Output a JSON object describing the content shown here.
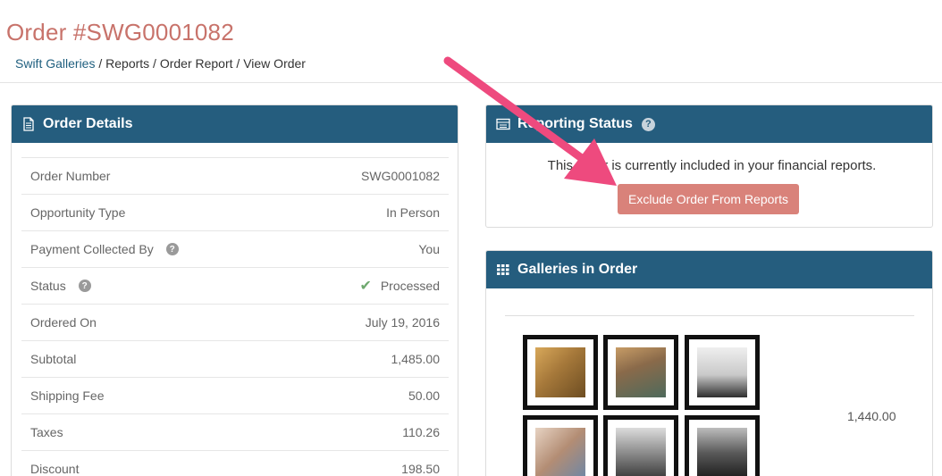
{
  "page": {
    "title": "Order #SWG0001082",
    "breadcrumb": {
      "home": "Swift Galleries",
      "rest": " / Reports / Order Report / View Order"
    }
  },
  "order_details": {
    "heading": "Order Details",
    "rows": [
      {
        "label": "Order Number",
        "value": "SWG0001082"
      },
      {
        "label": "Opportunity Type",
        "value": "In Person"
      },
      {
        "label": "Payment Collected By",
        "value": "You"
      },
      {
        "label": "Status",
        "value": "Processed"
      },
      {
        "label": "Ordered On",
        "value": "July 19, 2016"
      },
      {
        "label": "Subtotal",
        "value": "1,485.00"
      },
      {
        "label": "Shipping Fee",
        "value": "50.00"
      },
      {
        "label": "Taxes",
        "value": "110.26"
      },
      {
        "label": "Discount",
        "value": "198.50"
      }
    ]
  },
  "reporting_status": {
    "heading": "Reporting Status",
    "message": "This order is currently included in your financial reports.",
    "button_label": "Exclude Order From Reports"
  },
  "galleries": {
    "heading": "Galleries in Order",
    "price": "1,440.00"
  },
  "colors": {
    "title": "#c8736b",
    "panel_header": "#255d7e",
    "button": "#d9827a",
    "annotation_arrow": "#ee4a7e"
  },
  "icons": {
    "order_details": "document-icon",
    "reporting_status": "list-icon",
    "galleries": "grid-icon",
    "help": "question-circle-icon",
    "status": "check-icon"
  }
}
